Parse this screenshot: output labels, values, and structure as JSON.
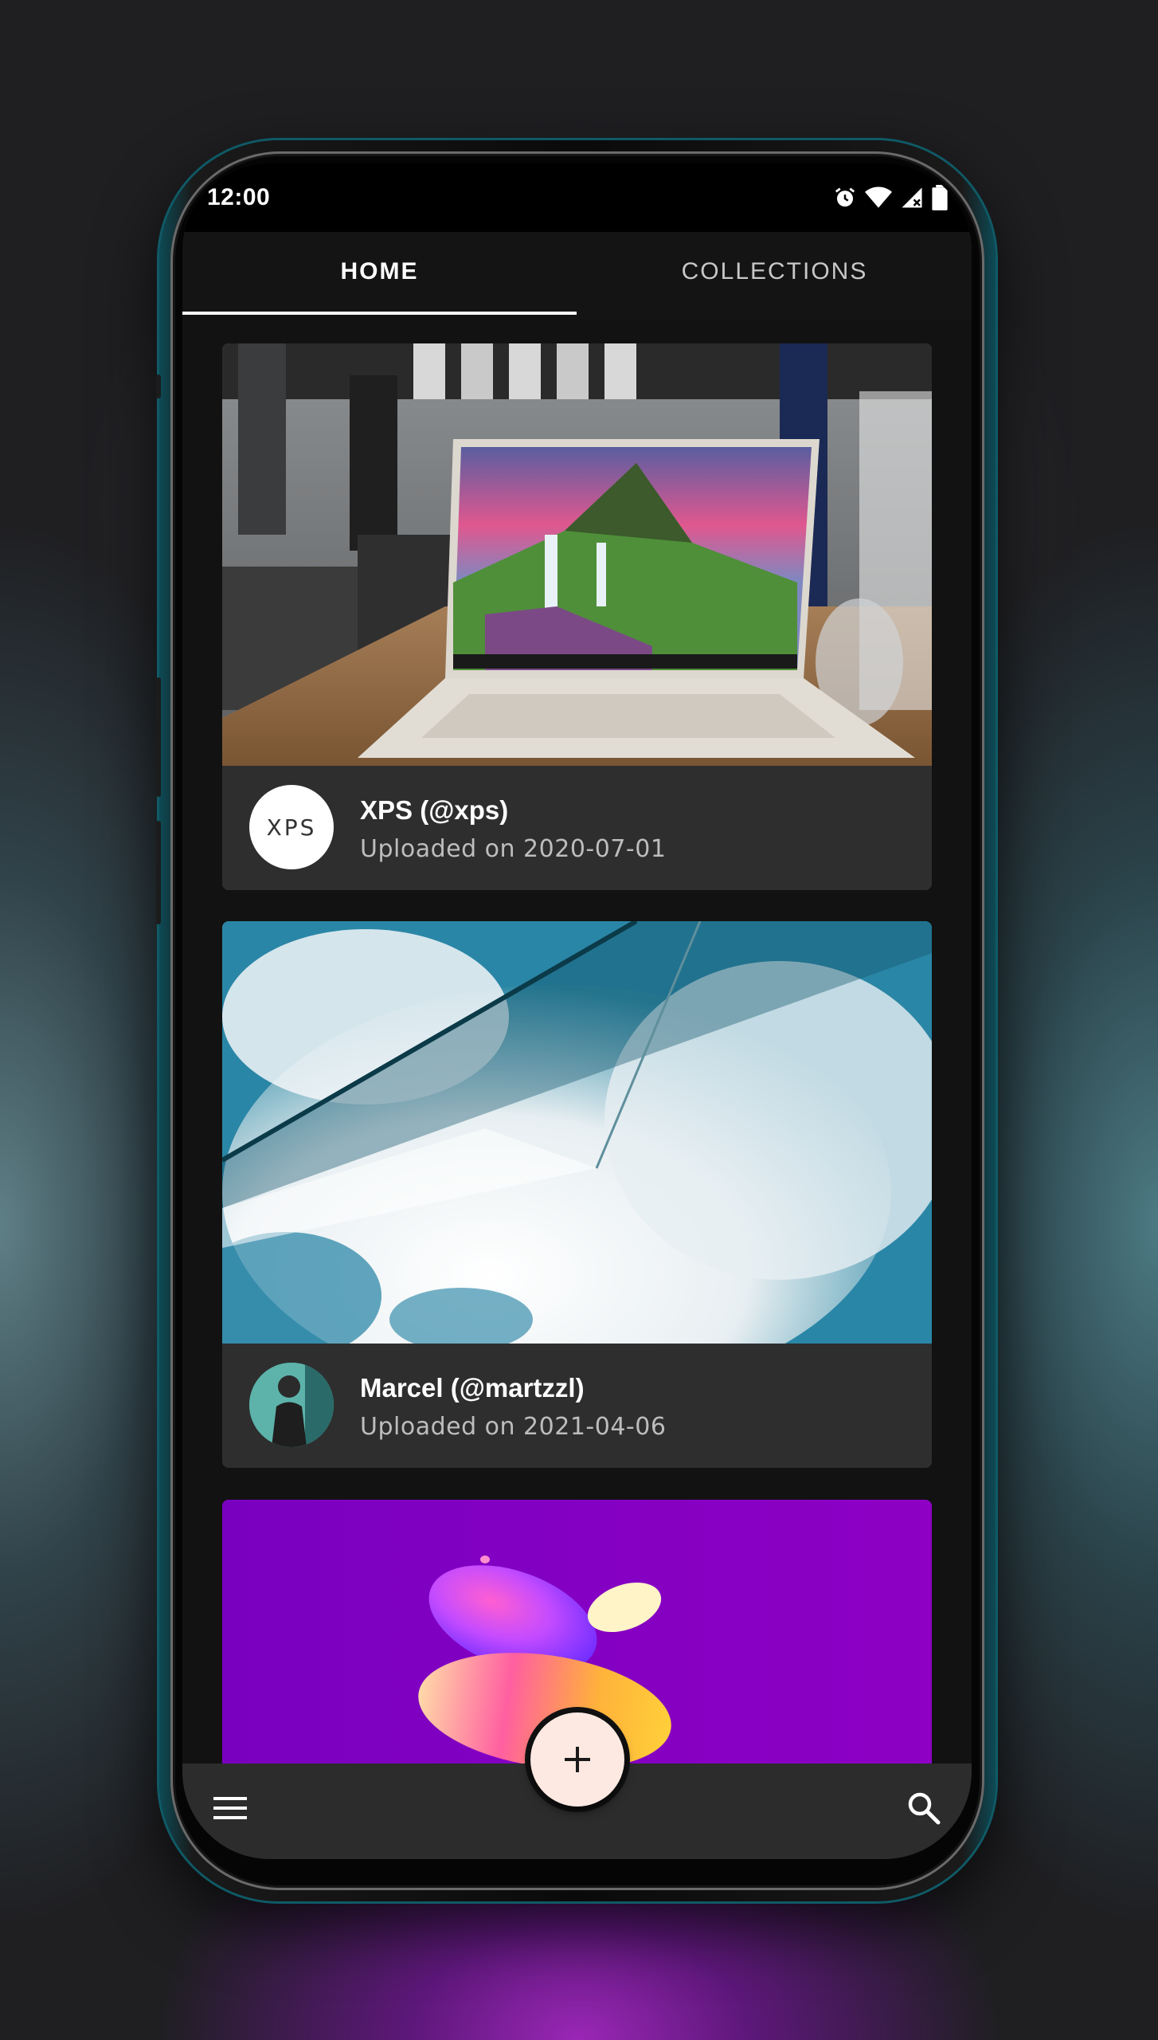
{
  "status_bar": {
    "time": "12:00",
    "icons": [
      "alarm-icon",
      "wifi-icon",
      "signal-icon",
      "battery-icon"
    ]
  },
  "tabs": [
    {
      "label": "HOME",
      "active": true
    },
    {
      "label": "COLLECTIONS",
      "active": false
    }
  ],
  "feed": [
    {
      "author": "XPS (@xps)",
      "uploaded": "Uploaded on 2020-07-01",
      "avatar": "XPS",
      "image": "laptop-photo"
    },
    {
      "author": "Marcel (@martzzl)",
      "uploaded": "Uploaded on 2021-04-06",
      "avatar": "portrait",
      "image": "sky-glass-photo"
    },
    {
      "author": "",
      "uploaded": "",
      "avatar": "",
      "image": "abstract-purple-photo"
    }
  ],
  "bottom_bar": {
    "left_icon": "menu-icon",
    "fab_icon": "plus-icon",
    "right_icon": "search-icon"
  },
  "colors": {
    "tab_indicator": "#ffffff",
    "fab": "#fde9e1",
    "surface": "#2d2d2d",
    "background": "#121212"
  }
}
